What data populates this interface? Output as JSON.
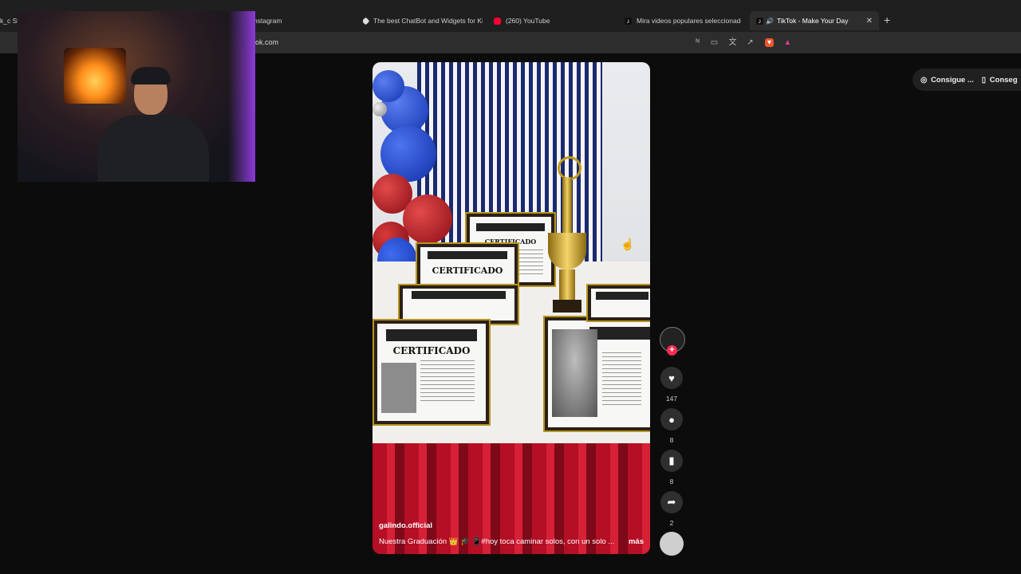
{
  "browser": {
    "tabs": [
      {
        "label": "k_c St",
        "favicon_color": "#888888"
      },
      {
        "label": "nstagram",
        "favicon_color": "#000000"
      },
      {
        "label": "The best ChatBot and Widgets for Ki",
        "favicon_color": "#dddddd"
      },
      {
        "label": "(260) YouTube",
        "favicon_color": "#ff0033"
      },
      {
        "label": "Mira videos populares seleccionados",
        "favicon_color": "#111111"
      },
      {
        "label": "TikTok - Make Your Day",
        "favicon_color": "#111111",
        "active": true
      }
    ],
    "new_tab": "+",
    "url": "ok.com"
  },
  "right_buttons": {
    "first": "Consigue ...",
    "second": "Conseg"
  },
  "video": {
    "username": "galindo.official",
    "caption": "Nuestra Graduación 👑 🎓 📱#hoy  toca caminar solos, con un solo ...",
    "more": "más",
    "cert_title": "CERTIFICADO",
    "brand": "BARBEROS GALINDO"
  },
  "actions": {
    "likes": "147",
    "comments": "8",
    "saves": "8",
    "shares": "2"
  }
}
